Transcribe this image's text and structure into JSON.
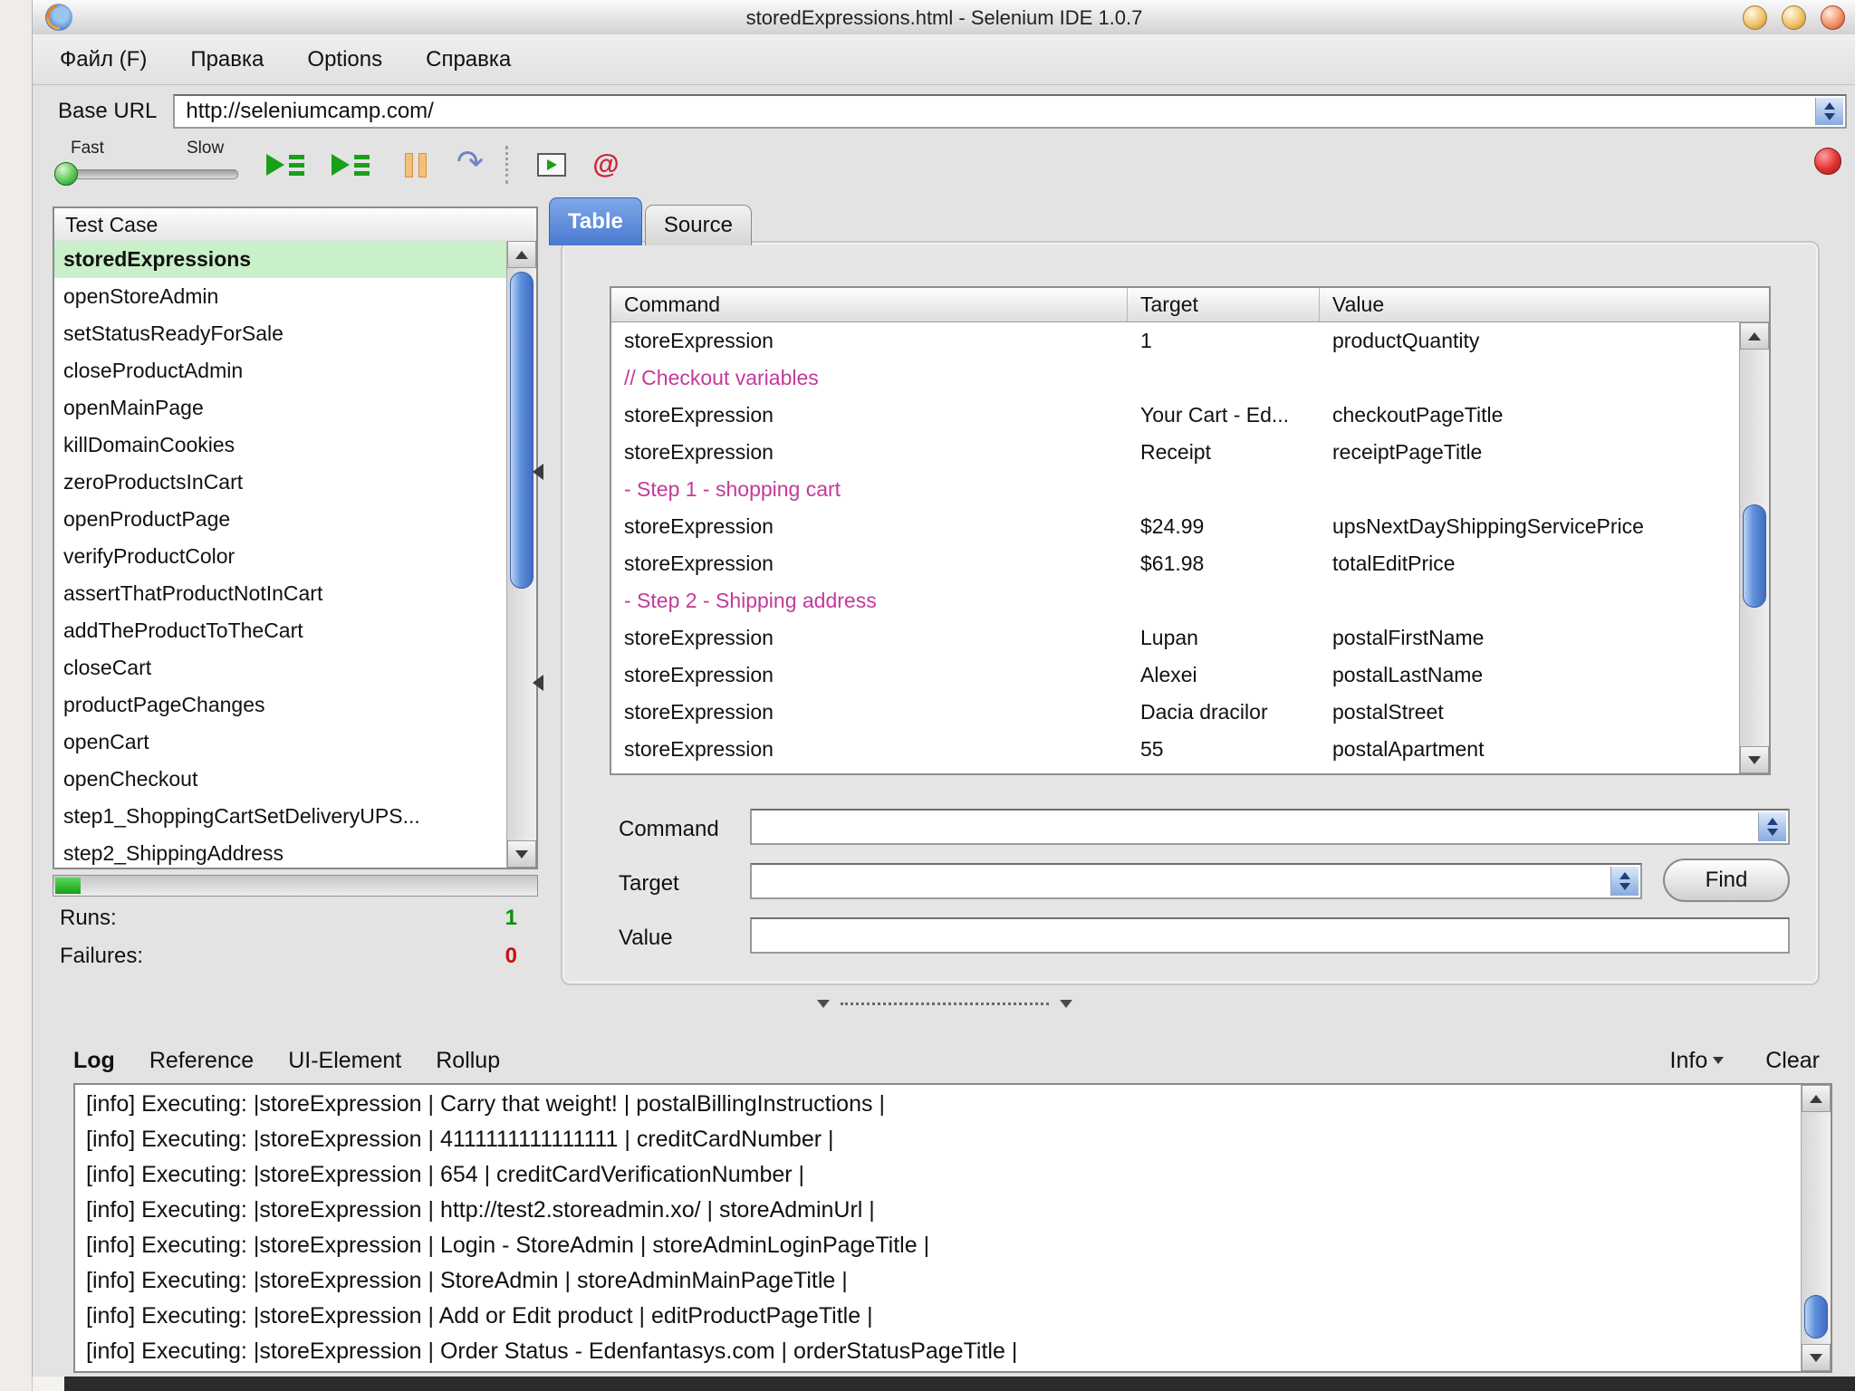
{
  "window": {
    "title": "storedExpressions.html - Selenium IDE 1.0.7"
  },
  "menu": {
    "items": [
      "Файл (F)",
      "Правка",
      "Options",
      "Справка"
    ]
  },
  "base_url": {
    "label": "Base URL",
    "value": "http://seleniumcamp.com/"
  },
  "toolbar": {
    "fast_label": "Fast",
    "slow_label": "Slow",
    "step_glyph": "↷",
    "rollup_glyph": "@"
  },
  "test_case_panel": {
    "header": "Test Case",
    "items": [
      {
        "label": "storedExpressions",
        "selected": true
      },
      {
        "label": "openStoreAdmin"
      },
      {
        "label": "setStatusReadyForSale"
      },
      {
        "label": "closeProductAdmin"
      },
      {
        "label": "openMainPage"
      },
      {
        "label": "killDomainCookies"
      },
      {
        "label": "zeroProductsInCart"
      },
      {
        "label": "openProductPage"
      },
      {
        "label": "verifyProductColor"
      },
      {
        "label": "assertThatProductNotInCart"
      },
      {
        "label": "addTheProductToTheCart"
      },
      {
        "label": "closeCart"
      },
      {
        "label": "productPageChanges"
      },
      {
        "label": "openCart"
      },
      {
        "label": "openCheckout"
      },
      {
        "label": "step1_ShoppingCartSetDeliveryUPS..."
      },
      {
        "label": "step2_ShippingAddress"
      }
    ],
    "runs_label": "Runs:",
    "runs_value": "1",
    "failures_label": "Failures:",
    "failures_value": "0"
  },
  "editor": {
    "tabs": [
      {
        "label": "Table",
        "active": true
      },
      {
        "label": "Source"
      }
    ],
    "columns": [
      "Command",
      "Target",
      "Value"
    ],
    "rows": [
      {
        "command": "storeExpression",
        "target": "1",
        "value": "productQuantity"
      },
      {
        "comment": "// Checkout variables"
      },
      {
        "command": "storeExpression",
        "target": "Your Cart - Ed...",
        "value": "checkoutPageTitle"
      },
      {
        "command": "storeExpression",
        "target": "Receipt",
        "value": "receiptPageTitle"
      },
      {
        "comment": "- Step 1 - shopping cart"
      },
      {
        "command": "storeExpression",
        "target": "$24.99",
        "value": "upsNextDayShippingServicePrice"
      },
      {
        "command": "storeExpression",
        "target": "$61.98",
        "value": "totalEditPrice"
      },
      {
        "comment": "- Step 2 - Shipping address"
      },
      {
        "command": "storeExpression",
        "target": "Lupan",
        "value": "postalFirstName"
      },
      {
        "command": "storeExpression",
        "target": "Alexei",
        "value": "postalLastName"
      },
      {
        "command": "storeExpression",
        "target": "Dacia dracilor",
        "value": "postalStreet"
      },
      {
        "command": "storeExpression",
        "target": "55",
        "value": "postalApartment"
      }
    ],
    "form": {
      "command_label": "Command",
      "target_label": "Target",
      "value_label": "Value",
      "command_value": "",
      "target_value": "",
      "value_value": "",
      "find_button": "Find"
    }
  },
  "log_panel": {
    "tabs": [
      {
        "label": "Log",
        "active": true
      },
      {
        "label": "Reference"
      },
      {
        "label": "UI-Element"
      },
      {
        "label": "Rollup"
      }
    ],
    "info_button": "Info",
    "clear_button": "Clear",
    "entries": [
      "[info] Executing: |storeExpression | Carry that weight! | postalBillingInstructions |",
      "[info] Executing: |storeExpression | 4111111111111111 | creditCardNumber |",
      "[info] Executing: |storeExpression | 654 | creditCardVerificationNumber |",
      "[info] Executing: |storeExpression | http://test2.storeadmin.xo/ | storeAdminUrl |",
      "[info] Executing: |storeExpression | Login - StoreAdmin | storeAdminLoginPageTitle |",
      "[info] Executing: |storeExpression | StoreAdmin | storeAdminMainPageTitle |",
      "[info] Executing: |storeExpression | Add or Edit product | editProductPageTitle |",
      "[info] Executing: |storeExpression | Order Status - Edenfantasys.com | orderStatusPageTitle |"
    ]
  },
  "colors": {
    "selected_row_green": "#c9f0c9",
    "comment_pink": "#c23a9a",
    "active_tab_blue": "#4a7ad0",
    "runs_green": "#089008",
    "failures_red": "#cc1010",
    "record_red": "#e03030"
  }
}
